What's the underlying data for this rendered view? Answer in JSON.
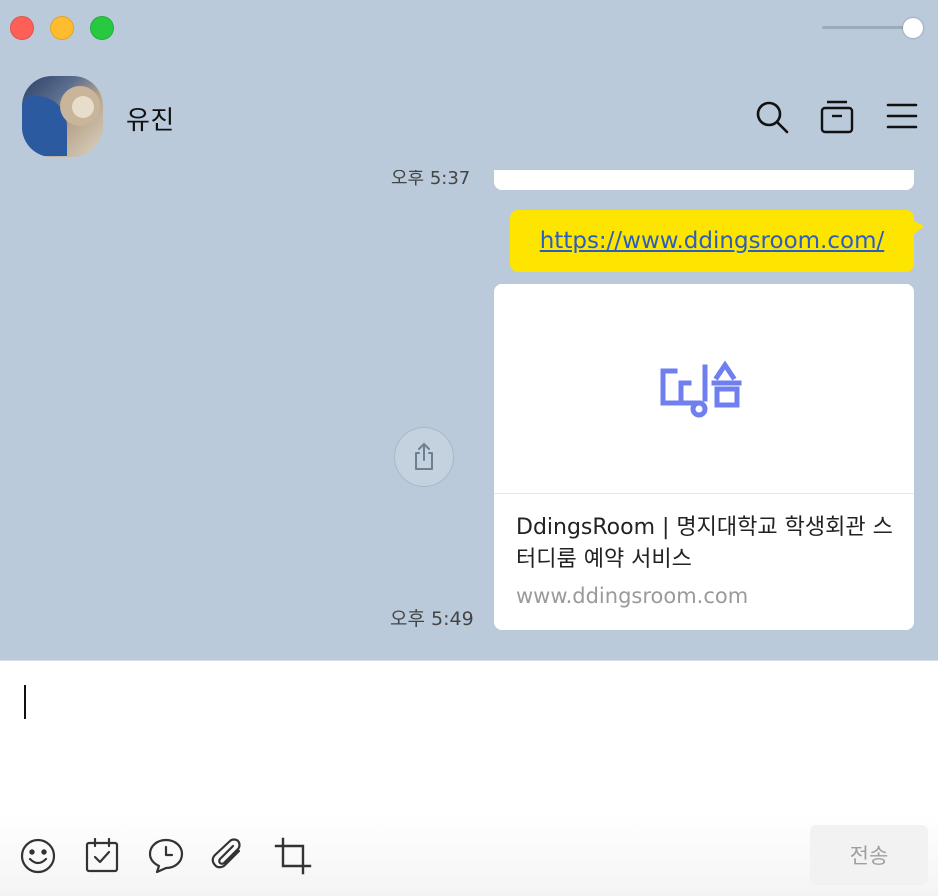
{
  "header": {
    "title": "유진"
  },
  "messages": {
    "previous_time": "오후 5:37",
    "link_text": "https://www.ddingsroom.com/",
    "card": {
      "logo_text": "띵룸",
      "title": "DdingsRoom | 명지대학교 학생회관 스터디룸 예약 서비스",
      "url": "www.ddingsroom.com"
    },
    "time": "오후 5:49"
  },
  "input": {
    "value": "",
    "send_label": "전송"
  },
  "colors": {
    "chat_bg": "#bacadb",
    "bubble": "#fee500",
    "link": "#2a5fc0",
    "logo": "#6f7ff0"
  },
  "icons": {
    "header": [
      "search-icon",
      "drawer-icon",
      "menu-icon"
    ],
    "toolbar": [
      "emoji-icon",
      "calendar-icon",
      "talk-icon",
      "attach-icon",
      "crop-icon"
    ],
    "share": "share-icon"
  }
}
